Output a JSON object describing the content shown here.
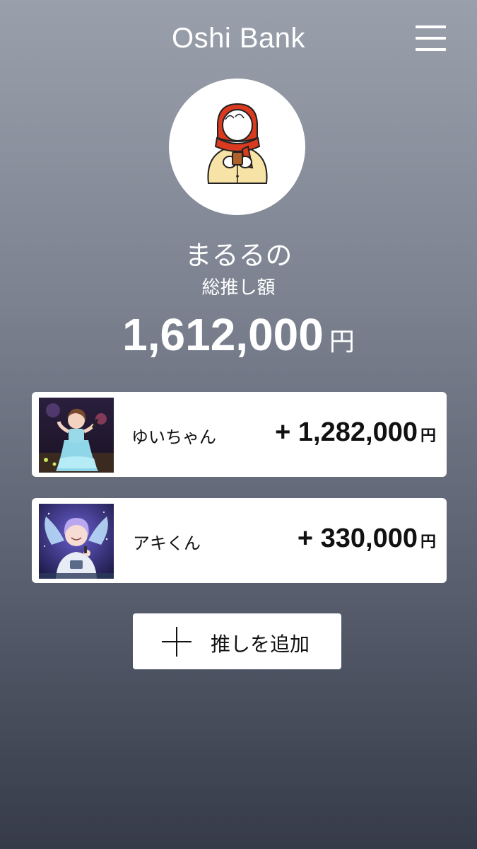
{
  "header": {
    "title": "Oshi Bank",
    "menu_icon": "hamburger-menu-icon"
  },
  "profile": {
    "avatar_icon": "girl-with-red-scarf-illustration",
    "name": "まるるの",
    "total_label": "総推し額",
    "total_amount": "1,612,000",
    "currency": "円"
  },
  "oshi_list": [
    {
      "name": "ゆいちゃん",
      "amount": "+ 1,282,000",
      "currency": "円",
      "thumbnail": "idol-performer-photo"
    },
    {
      "name": "アキくん",
      "amount": "+ 330,000",
      "currency": "円",
      "thumbnail": "astronaut-character-art"
    }
  ],
  "add_button": {
    "label": "推しを追加",
    "icon": "plus-icon"
  },
  "colors": {
    "background_top": "#9aa0ab",
    "background_bottom": "#363b49",
    "card": "#ffffff",
    "text_dark": "#111111"
  }
}
